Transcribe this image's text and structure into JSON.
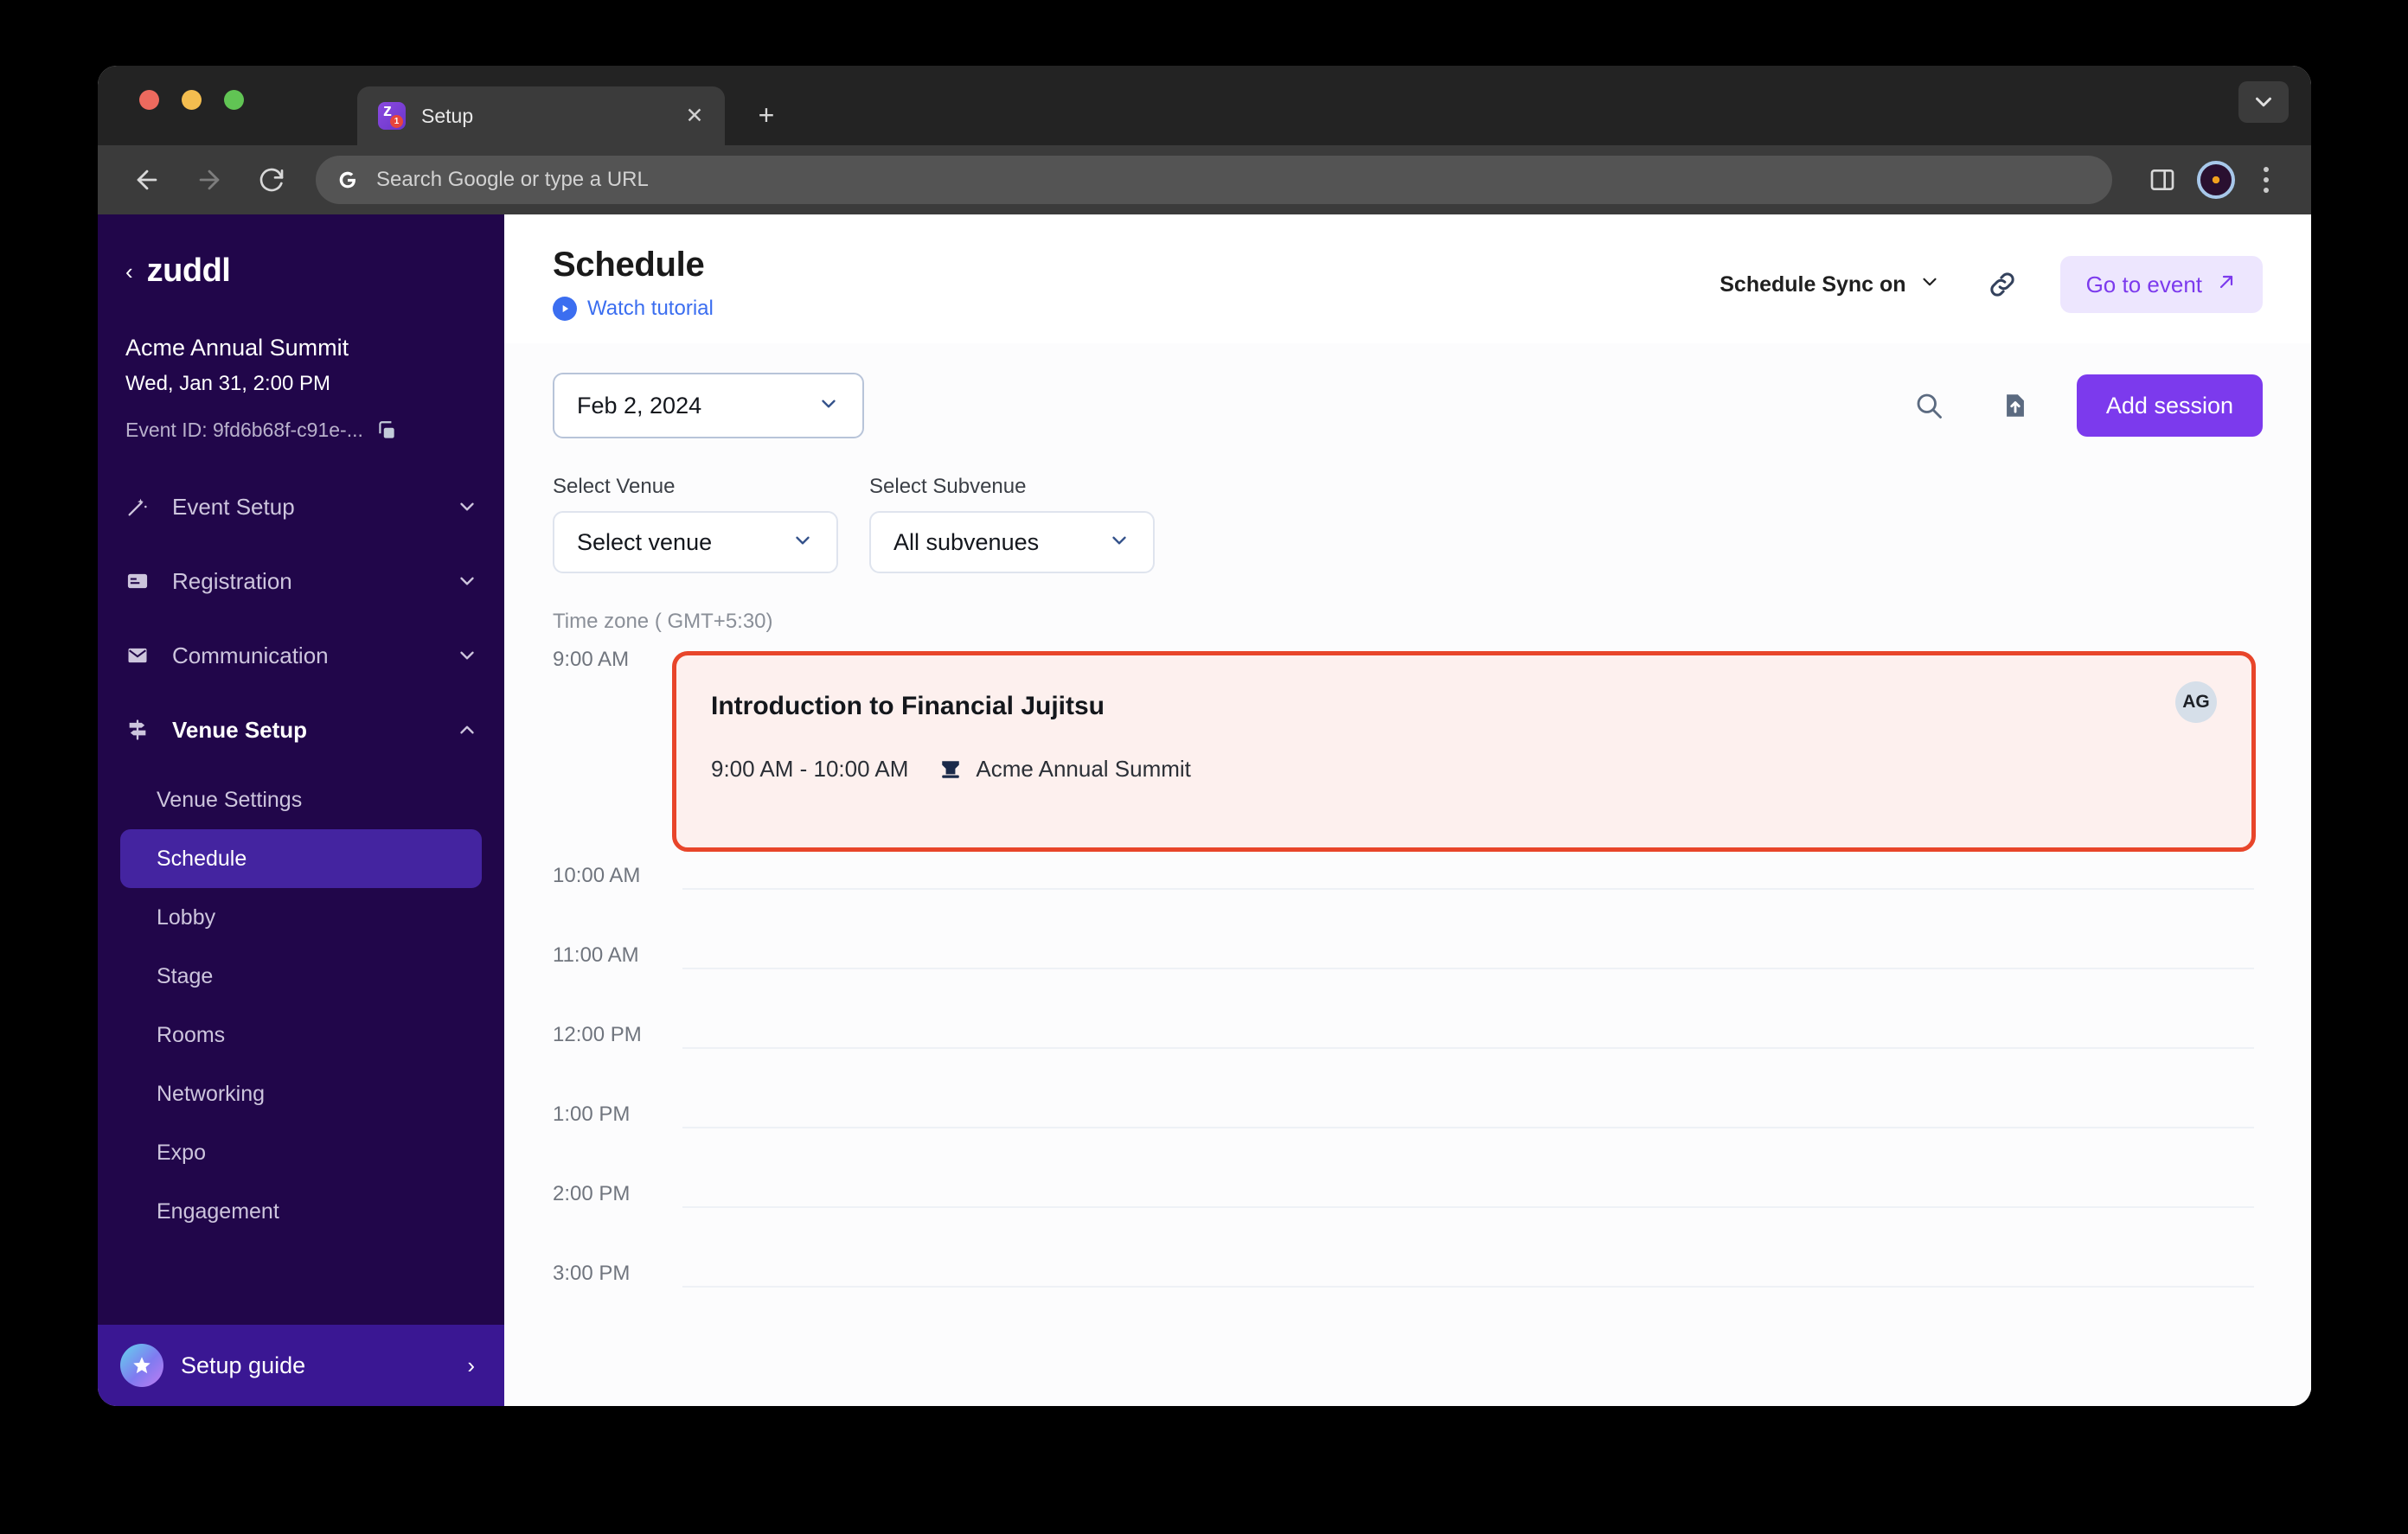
{
  "browser": {
    "tab": {
      "title": "Setup",
      "favicon": "zuddl-app-icon",
      "close_label": "✕"
    },
    "new_tab_label": "+",
    "omnibox": {
      "placeholder": "Search Google or type a URL",
      "search_engine_icon": "google-g-icon"
    },
    "nav": {
      "back_icon": "back-arrow-icon",
      "forward_icon": "forward-arrow-icon",
      "reload_icon": "reload-icon"
    },
    "toolbar_icons": [
      "side-panel-icon",
      "profile-avatar-icon",
      "chrome-menu-icon"
    ],
    "tabstrip_expand_icon": "chevron-down-icon"
  },
  "sidebar": {
    "brand": {
      "name": "zuddl",
      "back_chevron": "‹"
    },
    "event": {
      "name": "Acme Annual Summit",
      "date": "Wed, Jan 31, 2:00 PM",
      "event_id": "Event ID: 9fd6b68f-c91e-...",
      "copy_icon": "copy-icon"
    },
    "groups": [
      {
        "label": "Event Setup",
        "icon": "magic-wand-icon",
        "expanded": false,
        "active": false
      },
      {
        "label": "Registration",
        "icon": "registration-card-icon",
        "expanded": false,
        "active": false
      },
      {
        "label": "Communication",
        "icon": "envelope-icon",
        "expanded": false,
        "active": false
      },
      {
        "label": "Venue Setup",
        "icon": "signpost-icon",
        "expanded": true,
        "active": true
      }
    ],
    "subitems": [
      {
        "label": "Venue Settings",
        "selected": false
      },
      {
        "label": "Schedule",
        "selected": true
      },
      {
        "label": "Lobby",
        "selected": false
      },
      {
        "label": "Stage",
        "selected": false
      },
      {
        "label": "Rooms",
        "selected": false
      },
      {
        "label": "Networking",
        "selected": false
      },
      {
        "label": "Expo",
        "selected": false
      },
      {
        "label": "Engagement",
        "selected": false
      }
    ],
    "setup_guide": {
      "label": "Setup guide",
      "icon": "star-badge-icon",
      "chevron": "›"
    }
  },
  "header": {
    "title": "Schedule",
    "watch_tutorial": {
      "label": "Watch tutorial",
      "icon": "play-circle-icon"
    },
    "schedule_sync": {
      "label": "Schedule Sync on",
      "chevron_icon": "chevron-down-icon"
    },
    "link_icon": "link-chain-icon",
    "go_to_event": {
      "label": "Go to event",
      "icon": "external-link-arrow-icon"
    }
  },
  "controls": {
    "date_picker": {
      "value": "Feb 2, 2024",
      "chevron_icon": "chevron-down-icon"
    },
    "search_icon": "search-icon",
    "upload_icon": "upload-file-icon",
    "add_session": {
      "label": "Add session"
    }
  },
  "filters": {
    "venue": {
      "label": "Select Venue",
      "value": "Select venue",
      "chevron_icon": "chevron-down-icon"
    },
    "subvenue": {
      "label": "Select Subvenue",
      "value": "All subvenues",
      "chevron_icon": "chevron-down-icon"
    }
  },
  "schedule": {
    "timezone": "Time zone ( GMT+5:30)",
    "slots": [
      {
        "label": "9:00 AM"
      },
      {
        "label": "10:00 AM"
      },
      {
        "label": "11:00 AM"
      },
      {
        "label": "12:00 PM"
      },
      {
        "label": "1:00 PM"
      },
      {
        "label": "2:00 PM"
      },
      {
        "label": "3:00 PM"
      }
    ],
    "session": {
      "title": "Introduction to Financial Jujitsu",
      "time": "9:00 AM - 10:00 AM",
      "venue": "Acme Annual Summit",
      "venue_icon": "stage-venue-icon",
      "avatar_initials": "AG",
      "highlight_color": "#e8452a",
      "background_color": "#fdf0ee"
    }
  },
  "colors": {
    "sidebar_bg": "#21064a",
    "sidebar_selected": "#4424a0",
    "setup_guide_bg": "#3a1793",
    "primary": "#7c3aed",
    "link_blue": "#3b6ef0",
    "highlight_red": "#e8452a"
  }
}
